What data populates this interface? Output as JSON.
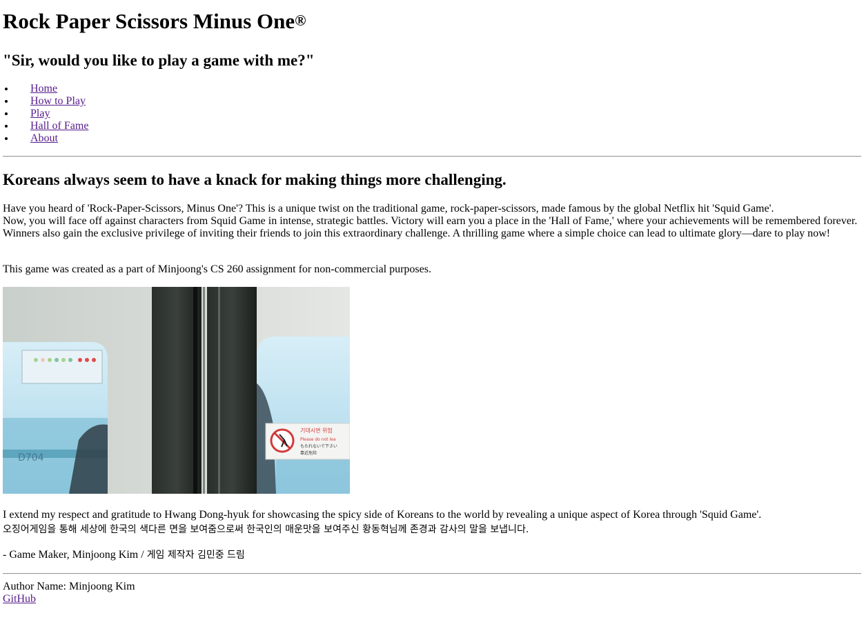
{
  "header": {
    "title": "Rock Paper Scissors Minus One",
    "title_mark": "®",
    "tagline": "\"Sir, would you like to play a game with me?\""
  },
  "nav": {
    "items": [
      {
        "label": "Home"
      },
      {
        "label": "How to Play"
      },
      {
        "label": "Play"
      },
      {
        "label": "Hall of Fame"
      },
      {
        "label": "About"
      }
    ]
  },
  "main": {
    "headline": "Koreans always seem to have a knack for making things more challenging.",
    "intro_lines": [
      "Have you heard of 'Rock-Paper-Scissors, Minus One'? This is a unique twist on the traditional game, rock-paper-scissors, made famous by the global Netflix hit 'Squid Game'.",
      "Now, you will face off against characters from Squid Game in intense, strategic battles. Victory will earn you a place in the 'Hall of Fame,' where your achievements will be remembered forever.",
      "Winners also gain the exclusive privilege of inviting their friends to join this extraordinary challenge. A thrilling game where a simple choice can lead to ultimate glory—dare to play now!"
    ],
    "credit": "This game was created as a part of Minjoong's CS 260 assignment for non-commercial purposes.",
    "photo": {
      "sign_title": "기대시면 위험",
      "sign_line1": "Please do not lea",
      "sign_line2": "もたれないで下さい",
      "sign_line3": "靠近危险",
      "car_number": "D704",
      "colors": {
        "sky": "#bfe3f2",
        "frame": "#d9ddd8",
        "door": "#1f2320",
        "sign_red": "#d23a3a"
      }
    },
    "thanks_en": "I extend my respect and gratitude to Hwang Dong-hyuk for showcasing the spicy side of Koreans to the world by revealing a unique aspect of Korea through 'Squid Game'.",
    "thanks_ko": "오징어게임을 통해 세상에 한국의 색다른 면을 보여줌으로써 한국인의 매운맛을 보여주신 황동혁님께 존경과 감사의 말을 보냅니다.",
    "signoff_en": "- Game Maker, Minjoong Kim / ",
    "signoff_ko": "게임 제작자 김민중 드림"
  },
  "footer": {
    "author": "Author Name: Minjoong Kim",
    "github_label": "GitHub"
  },
  "colors": {
    "link": "#551a8b",
    "rule": "#9a9a9a"
  }
}
